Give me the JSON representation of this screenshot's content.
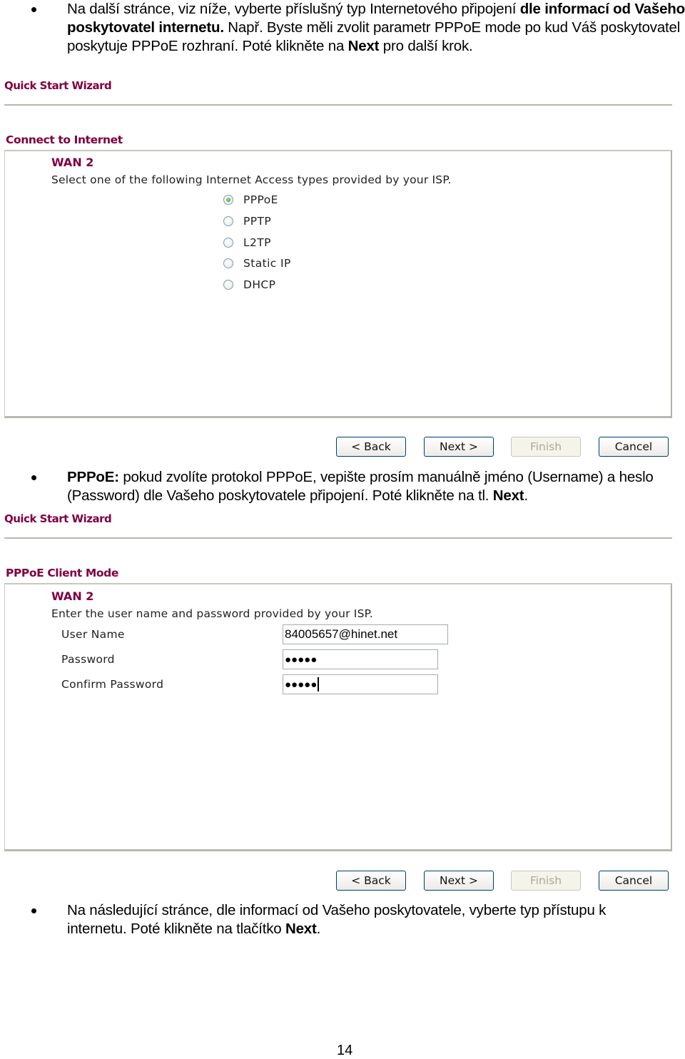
{
  "paragraph1": {
    "text_a": "Na další stránce, viz níže, vyberte příslušný typ Internetového připojení ",
    "bold_a": "dle informací od Vašeho poskytovatel internetu.",
    "text_b": " Např. Byste měli zvolit parametr PPPoE mode po kud Váš poskytovatel poskytuje PPPoE rozhraní. Poté klikněte na ",
    "bold_b": "Next",
    "text_c": " pro další krok."
  },
  "wizard1": {
    "title": "Quick Start Wizard",
    "section_title": "Connect to Internet",
    "wan": "WAN 2",
    "description": "Select one of the following Internet Access types provided by your ISP.",
    "options": [
      {
        "label": "PPPoE",
        "checked": true
      },
      {
        "label": "PPTP",
        "checked": false
      },
      {
        "label": "L2TP",
        "checked": false
      },
      {
        "label": "Static IP",
        "checked": false
      },
      {
        "label": "DHCP",
        "checked": false
      }
    ],
    "buttons": {
      "back": "< Back",
      "next": "Next >",
      "finish": "Finish",
      "cancel": "Cancel"
    }
  },
  "paragraph2": {
    "bold_a": "PPPoE:",
    "text_a": " pokud zvolíte protokol PPPoE, vepište prosím manuálně jméno (Username) a heslo (Password) dle Vašeho poskytovatele připojení. Poté klikněte na tl. ",
    "bold_b": "Next",
    "text_b": "."
  },
  "wizard2": {
    "title": "Quick Start Wizard",
    "section_title": "PPPoE Client Mode",
    "wan": "WAN 2",
    "description": "Enter the user name and password provided by your ISP.",
    "fields": {
      "username_label": "User Name",
      "username_value": "84005657@hinet.net",
      "password_label": "Password",
      "password_value": "●●●●●",
      "confirm_label": "Confirm Password",
      "confirm_value": "●●●●●"
    },
    "buttons": {
      "back": "< Back",
      "next": "Next >",
      "finish": "Finish",
      "cancel": "Cancel"
    }
  },
  "paragraph3": {
    "text_a": "Na následující stránce, dle informací od Vašeho poskytovatele, vyberte typ přístupu k internetu. Poté klikněte na tlačítko ",
    "bold_a": "Next",
    "text_b": "."
  },
  "page_number": "14"
}
